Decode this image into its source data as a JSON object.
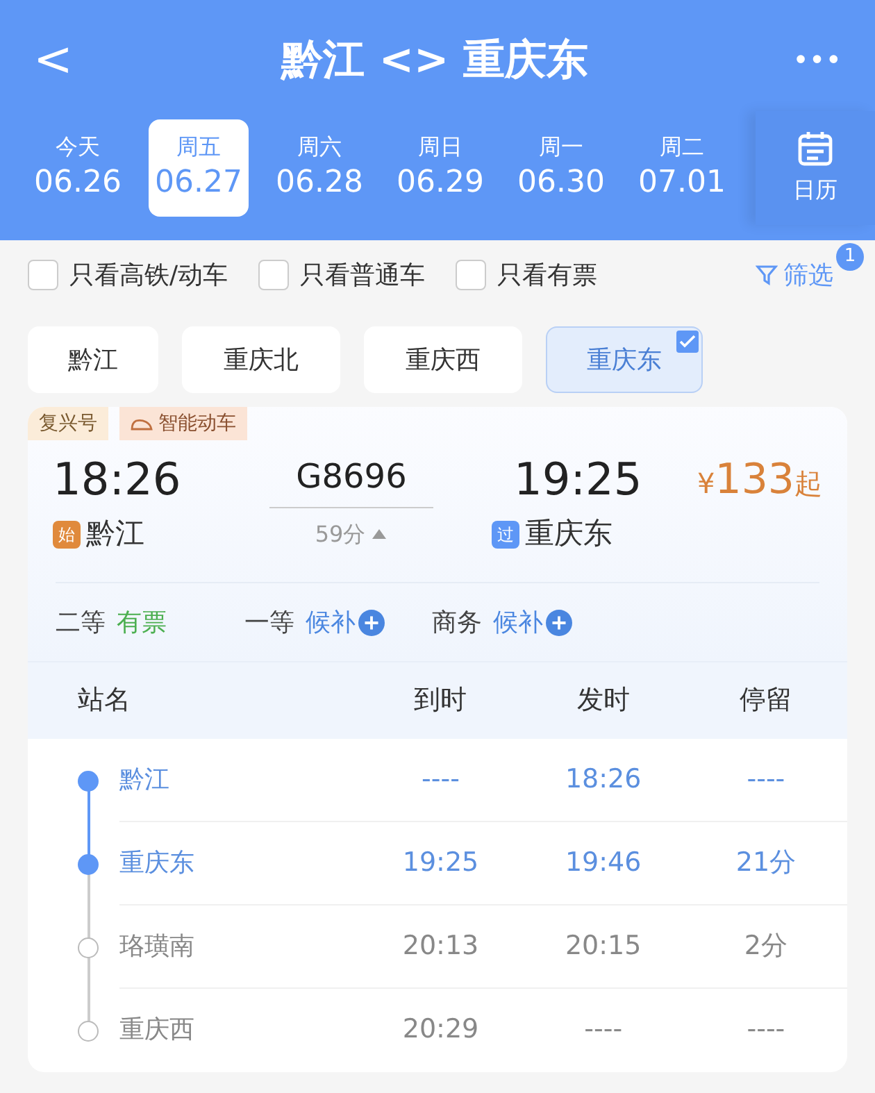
{
  "header": {
    "back": "<",
    "title": "黔江 <> 重庆东",
    "more": "•••"
  },
  "dates": [
    {
      "weekday": "今天",
      "date": "06.26",
      "selected": false
    },
    {
      "weekday": "周五",
      "date": "06.27",
      "selected": true
    },
    {
      "weekday": "周六",
      "date": "06.28",
      "selected": false
    },
    {
      "weekday": "周日",
      "date": "06.29",
      "selected": false
    },
    {
      "weekday": "周一",
      "date": "06.30",
      "selected": false
    },
    {
      "weekday": "周二",
      "date": "07.01",
      "selected": false
    }
  ],
  "calendar": {
    "label": "日历"
  },
  "filters": [
    {
      "label": "只看高铁/动车",
      "checked": false
    },
    {
      "label": "只看普通车",
      "checked": false
    },
    {
      "label": "只看有票",
      "checked": false
    }
  ],
  "filter_button": {
    "label": "筛选",
    "badge": "1"
  },
  "stations": [
    {
      "label": "黔江",
      "selected": false
    },
    {
      "label": "重庆北",
      "selected": false
    },
    {
      "label": "重庆西",
      "selected": false
    },
    {
      "label": "重庆东",
      "selected": true
    }
  ],
  "train": {
    "tags": [
      "复兴号",
      "智能动车"
    ],
    "depart_time": "18:26",
    "train_no": "G8696",
    "arrive_time": "19:25",
    "price_symbol": "¥",
    "price": "133",
    "price_suffix": "起",
    "from_badge": "始",
    "from": "黔江",
    "duration": "59分",
    "to_badge": "过",
    "to": "重庆东",
    "seats": [
      {
        "class": "二等",
        "status": "有票",
        "kind": "available"
      },
      {
        "class": "一等",
        "status": "候补",
        "kind": "waitlist"
      },
      {
        "class": "商务",
        "status": "候补",
        "kind": "waitlist"
      }
    ]
  },
  "stops_table": {
    "columns": [
      "站名",
      "到时",
      "发时",
      "停留"
    ],
    "rows": [
      {
        "station": "黔江",
        "arrive": "----",
        "depart": "18:26",
        "stay": "----",
        "in_segment": true
      },
      {
        "station": "重庆东",
        "arrive": "19:25",
        "depart": "19:46",
        "stay": "21分",
        "in_segment": true
      },
      {
        "station": "珞璜南",
        "arrive": "20:13",
        "depart": "20:15",
        "stay": "2分",
        "in_segment": false
      },
      {
        "station": "重庆西",
        "arrive": "20:29",
        "depart": "----",
        "stay": "----",
        "in_segment": false
      }
    ]
  }
}
